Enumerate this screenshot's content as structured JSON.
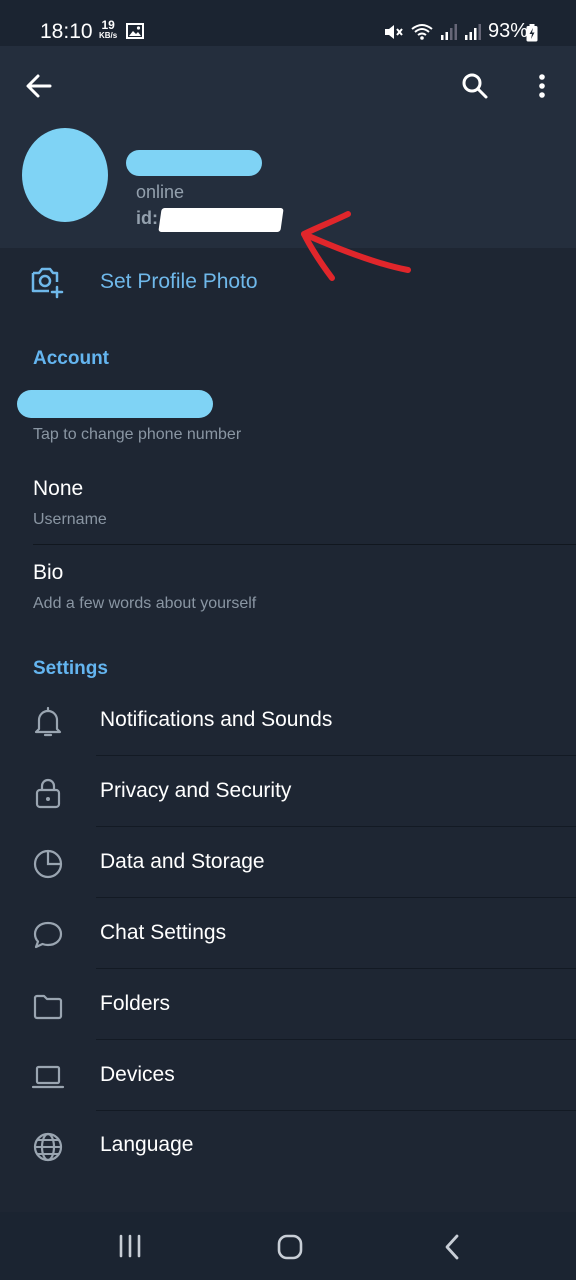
{
  "status_bar": {
    "time": "18:10",
    "net_speed_value": "19",
    "net_speed_unit": "KB/s",
    "battery": "93%"
  },
  "profile": {
    "status": "online",
    "id_label": "id:"
  },
  "set_photo_label": "Set Profile Photo",
  "account": {
    "title": "Account",
    "phone_hint": "Tap to change phone number",
    "username_value": "None",
    "username_label": "Username",
    "bio_value": "Bio",
    "bio_hint": "Add a few words about yourself"
  },
  "settings": {
    "title": "Settings",
    "items": [
      {
        "label": "Notifications and Sounds",
        "icon": "bell-icon"
      },
      {
        "label": "Privacy and Security",
        "icon": "lock-icon"
      },
      {
        "label": "Data and Storage",
        "icon": "pie-chart-icon"
      },
      {
        "label": "Chat Settings",
        "icon": "chat-bubble-icon"
      },
      {
        "label": "Folders",
        "icon": "folder-icon"
      },
      {
        "label": "Devices",
        "icon": "laptop-icon"
      },
      {
        "label": "Language",
        "icon": "globe-icon"
      }
    ]
  },
  "colors": {
    "background": "#1e2633",
    "header": "#242e3d",
    "accent": "#64b5f0",
    "redaction": "#7fd3f5",
    "annotation_arrow": "#e0262b"
  }
}
